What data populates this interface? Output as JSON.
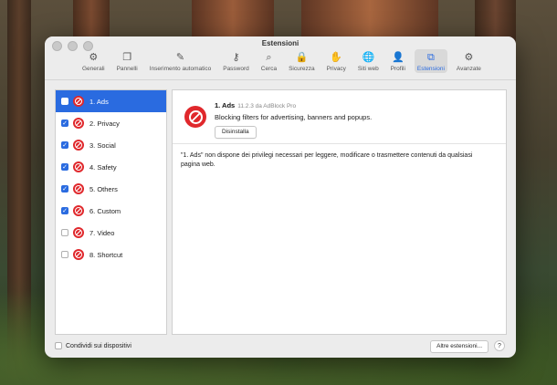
{
  "window": {
    "title": "Estensioni"
  },
  "toolbar": {
    "tabs": [
      {
        "label": "Generali",
        "icon": "gear-icon",
        "glyph": "⚙"
      },
      {
        "label": "Pannelli",
        "icon": "tabs-icon",
        "glyph": "❐"
      },
      {
        "label": "Inserimento automatico",
        "icon": "autofill-icon",
        "glyph": "✎"
      },
      {
        "label": "Password",
        "icon": "key-icon",
        "glyph": "⚷"
      },
      {
        "label": "Cerca",
        "icon": "search-icon",
        "glyph": "⌕"
      },
      {
        "label": "Sicurezza",
        "icon": "lock-icon",
        "glyph": "🔒"
      },
      {
        "label": "Privacy",
        "icon": "hand-icon",
        "glyph": "✋"
      },
      {
        "label": "Siti web",
        "icon": "globe-icon",
        "glyph": "🌐"
      },
      {
        "label": "Profili",
        "icon": "person-icon",
        "glyph": "👤"
      },
      {
        "label": "Estensioni",
        "icon": "puzzle-icon",
        "glyph": "⧉",
        "active": true
      },
      {
        "label": "Avanzate",
        "icon": "advanced-gears-icon",
        "glyph": "⚙"
      }
    ]
  },
  "extensions": [
    {
      "label": "1. Ads",
      "checked": false,
      "selected": true
    },
    {
      "label": "2. Privacy",
      "checked": true
    },
    {
      "label": "3. Social",
      "checked": true
    },
    {
      "label": "4. Safety",
      "checked": true
    },
    {
      "label": "5. Others",
      "checked": true
    },
    {
      "label": "6. Custom",
      "checked": true
    },
    {
      "label": "7. Video",
      "checked": false
    },
    {
      "label": "8. Shortcut",
      "checked": false
    }
  ],
  "detail": {
    "name": "1. Ads",
    "version": "11.2.3 da AdBlock Pro",
    "description": "Blocking filters for advertising, banners and popups.",
    "uninstall_label": "Disinstalla",
    "message": "\"1. Ads\" non dispone dei privilegi necessari per leggere, modificare o trasmettere contenuti da qualsiasi pagina web."
  },
  "footer": {
    "share_label": "Condividi sui dispositivi",
    "more_label": "Altre estensioni...",
    "help_label": "?"
  },
  "colors": {
    "accent": "#2a6be0",
    "stop_red": "#e0282c"
  }
}
